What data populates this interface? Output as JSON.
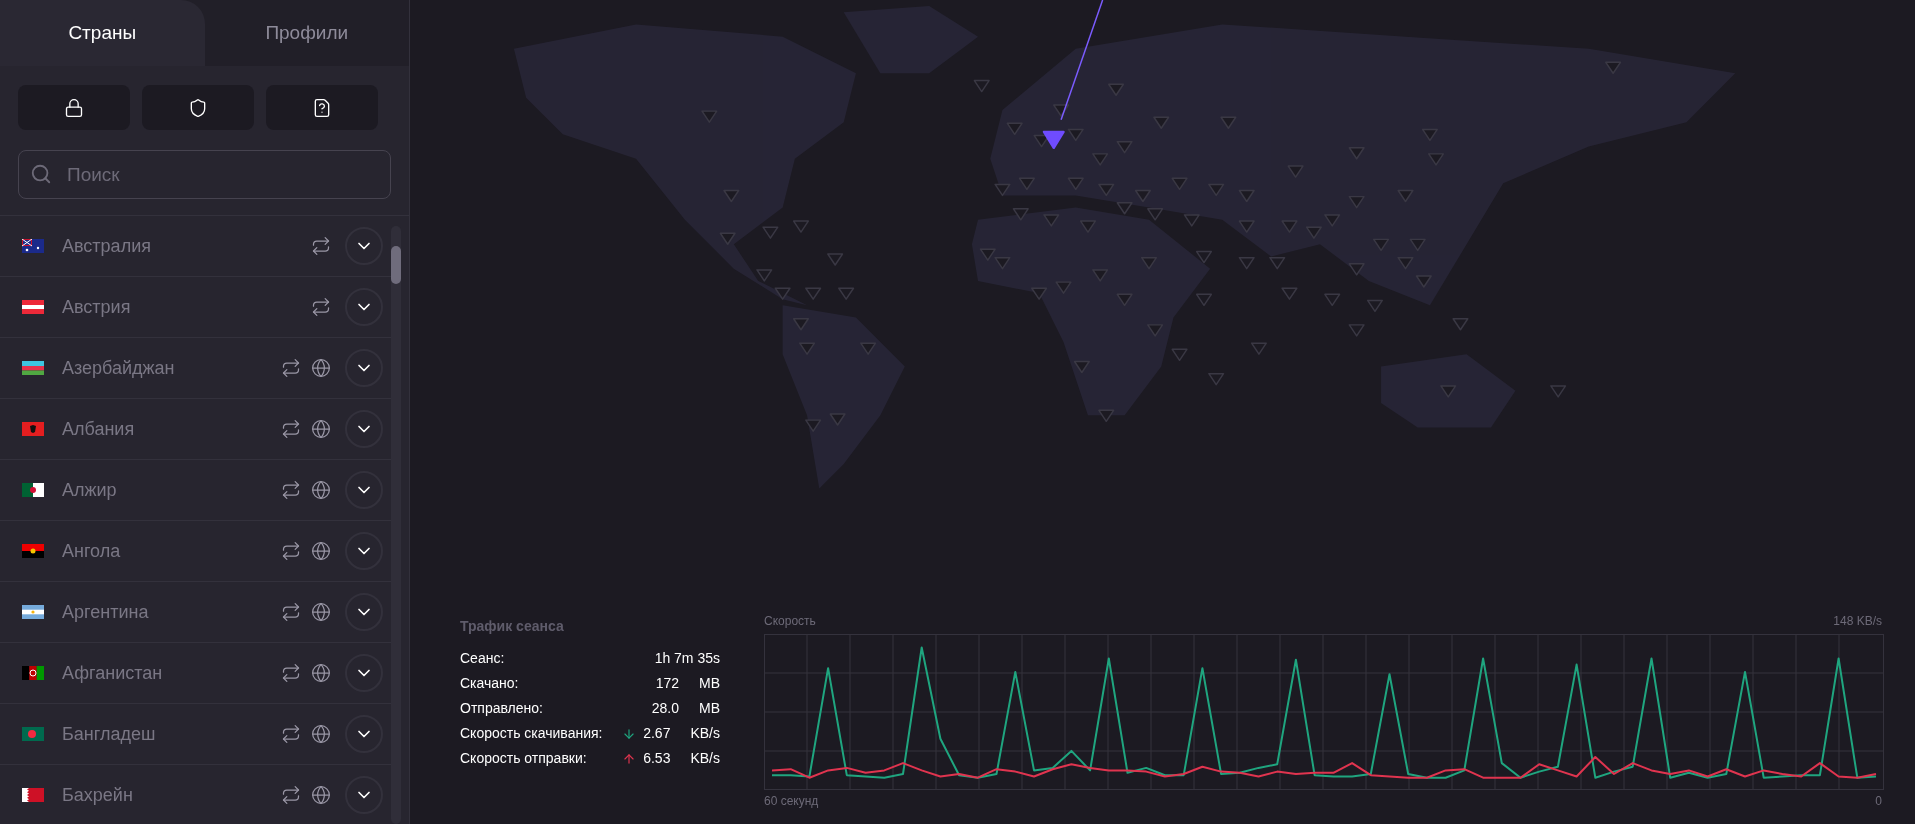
{
  "tabs": [
    {
      "label": "Страны",
      "selected": true
    },
    {
      "label": "Профили",
      "selected": false
    }
  ],
  "search": {
    "placeholder": "Поиск"
  },
  "countries": [
    {
      "name": "Австралия",
      "globe": false
    },
    {
      "name": "Австрия",
      "globe": false
    },
    {
      "name": "Азербайджан",
      "globe": true
    },
    {
      "name": "Албания",
      "globe": true
    },
    {
      "name": "Алжир",
      "globe": true
    },
    {
      "name": "Ангола",
      "globe": true
    },
    {
      "name": "Аргентина",
      "globe": true
    },
    {
      "name": "Афганистан",
      "globe": true
    },
    {
      "name": "Бангладеш",
      "globe": true
    },
    {
      "name": "Бахрейн",
      "globe": true
    }
  ],
  "session_traffic": {
    "title": "Трафик сеанса",
    "rows": [
      {
        "kind": "plain",
        "label": "Сеанс:",
        "value": "1h 7m 35s"
      },
      {
        "kind": "plain",
        "label": "Скачано:",
        "value": "172",
        "unit": "MB"
      },
      {
        "kind": "plain",
        "label": "Отправлено:",
        "value": "28.0",
        "unit": "MB"
      },
      {
        "kind": "download",
        "label": "Скорость скачивания:",
        "value": "2.67",
        "unit": "KB/s"
      },
      {
        "kind": "upload",
        "label": "Скорость отправки:",
        "value": "6.53",
        "unit": "KB/s"
      }
    ]
  },
  "speed_chart": {
    "chart_data": {
      "type": "line",
      "title": "Скорость",
      "xlabel": "60 секунд",
      "grid": true,
      "ylim": [
        0,
        148
      ],
      "yticks": [
        {
          "value": 0,
          "label": "0"
        },
        {
          "value": 148,
          "label": "148 KB/s"
        }
      ],
      "series": [
        {
          "color": "#1fa57f",
          "values": [
            22,
            22,
            21,
            110,
            22,
            21,
            20,
            23,
            127,
            52,
            22,
            20,
            23,
            107,
            26,
            28,
            42,
            26,
            118,
            24,
            28,
            22,
            22,
            110,
            23,
            24,
            28,
            31,
            117,
            22,
            21,
            21,
            23,
            105,
            23,
            20,
            20,
            26,
            118,
            32,
            20,
            25,
            29,
            113,
            20,
            25,
            29,
            118,
            20,
            24,
            20,
            23,
            107,
            20,
            21,
            22,
            22,
            118,
            20,
            21
          ]
        },
        {
          "color": "#e0344f",
          "values": [
            26,
            27,
            20,
            26,
            28,
            24,
            26,
            32,
            26,
            21,
            23,
            20,
            27,
            25,
            21,
            27,
            31,
            28,
            26,
            26,
            25,
            21,
            23,
            29,
            25,
            24,
            21,
            25,
            23,
            24,
            24,
            32,
            22,
            21,
            20,
            20,
            26,
            27,
            20,
            20,
            20,
            31,
            26,
            21,
            37,
            23,
            32,
            26,
            23,
            26,
            21,
            27,
            21,
            26,
            23,
            21,
            32,
            21,
            20,
            23
          ]
        }
      ]
    }
  }
}
